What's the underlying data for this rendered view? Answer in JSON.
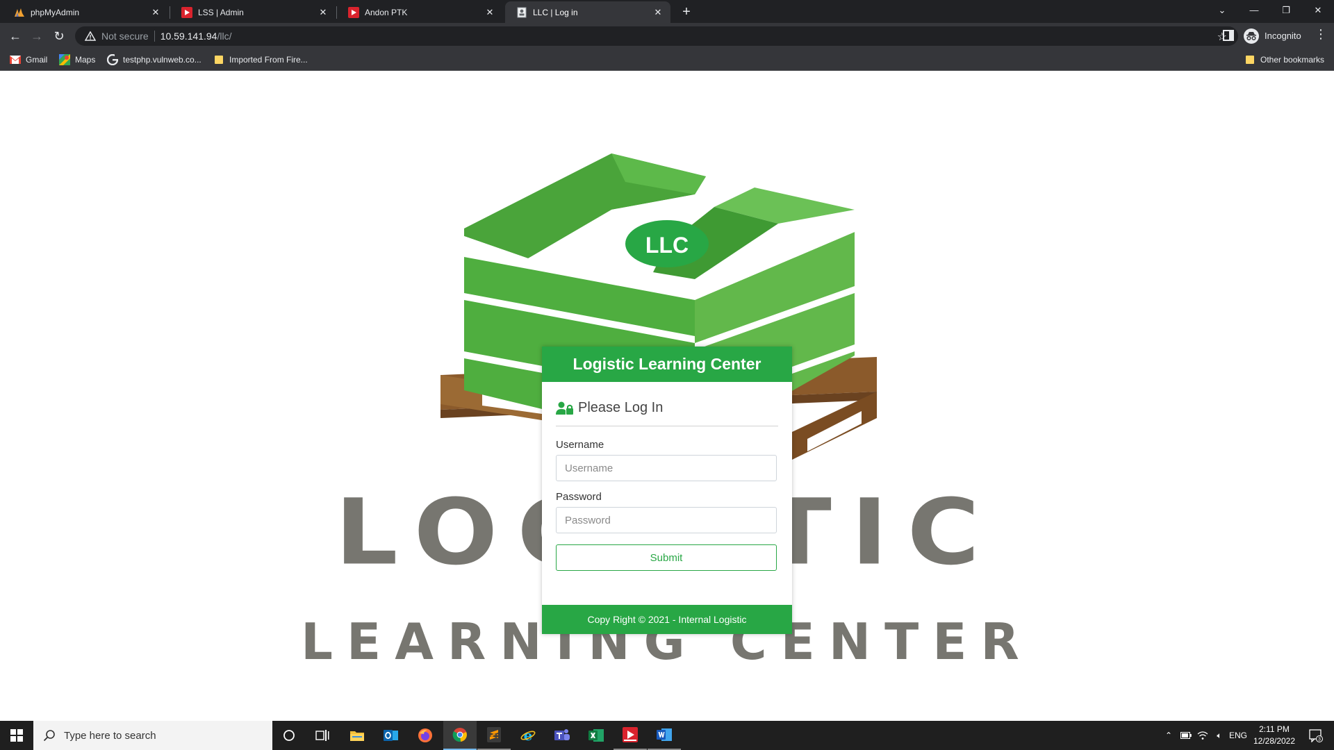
{
  "browser": {
    "tabs": [
      {
        "title": "phpMyAdmin",
        "icon": "phpmyadmin-icon",
        "active": false
      },
      {
        "title": "LSS | Admin",
        "icon": "red-play-icon",
        "active": false
      },
      {
        "title": "Andon PTK",
        "icon": "red-play-icon",
        "active": false
      },
      {
        "title": "LLC | Log in",
        "icon": "page-icon",
        "active": true
      }
    ],
    "new_tab_label": "+",
    "address": {
      "security_text": "Not secure",
      "url_host": "10.59.141.94",
      "url_path": "/llc/"
    },
    "profile_label": "Incognito",
    "bookmarks": [
      {
        "label": "Gmail",
        "icon": "gmail-icon"
      },
      {
        "label": "Maps",
        "icon": "maps-icon"
      },
      {
        "label": "testphp.vulnweb.co...",
        "icon": "google-icon"
      },
      {
        "label": "Imported From Fire...",
        "icon": "folder-icon"
      }
    ],
    "other_bookmarks": "Other bookmarks"
  },
  "page": {
    "logo_badge": "LLC",
    "hero_line_1": "LOGISTIC",
    "hero_line_2": "LEARNING CENTER",
    "brand_green": "#28a745",
    "hero_gray": "#777670"
  },
  "login": {
    "header": "Logistic Learning Center",
    "subtitle": "Please Log In",
    "username_label": "Username",
    "username_placeholder": "Username",
    "password_label": "Password",
    "password_placeholder": "Password",
    "submit_label": "Submit",
    "footer": "Copy Right © 2021 - Internal Logistic"
  },
  "taskbar": {
    "search_placeholder": "Type here to search",
    "language": "ENG",
    "time": "2:11 PM",
    "date": "12/28/2022",
    "notification_count": "3"
  }
}
